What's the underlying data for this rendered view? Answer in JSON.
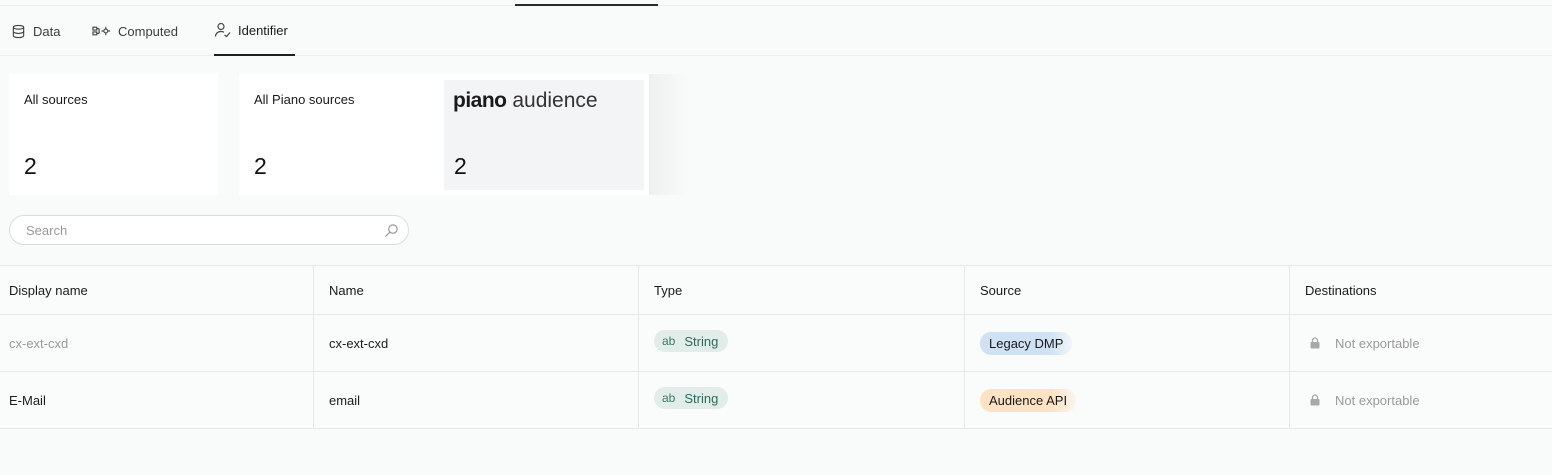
{
  "tabs": [
    {
      "label": "Data",
      "icon": "database-icon"
    },
    {
      "label": "Computed",
      "icon": "computed-icon"
    },
    {
      "label": "Identifier",
      "icon": "user-check-icon",
      "active": true
    }
  ],
  "source_cards": {
    "all_sources": {
      "label": "All sources",
      "count": "2"
    },
    "all_piano_sources": {
      "label": "All Piano sources",
      "count": "2"
    },
    "piano_audience": {
      "brand": "piano",
      "product": "audience",
      "count": "2"
    }
  },
  "search": {
    "placeholder": "Search",
    "value": ""
  },
  "table": {
    "columns": [
      "Display name",
      "Name",
      "Type",
      "Source",
      "Destinations"
    ],
    "rows": [
      {
        "display_name": "cx-ext-cxd",
        "name": "cx-ext-cxd",
        "type_icon": "ab",
        "type": "String",
        "source": "Legacy DMP",
        "destinations": "Not exportable"
      },
      {
        "display_name": "E-Mail",
        "name": "email",
        "type_icon": "ab",
        "type": "String",
        "source": "Audience API",
        "destinations": "Not exportable"
      }
    ]
  },
  "colors": {
    "type_pill_bg": "#e2ece9",
    "type_pill_text": "#2c6b5c",
    "legacy_dmp_bg": "#cfe1f3",
    "audience_api_bg": "#fde3c4"
  }
}
